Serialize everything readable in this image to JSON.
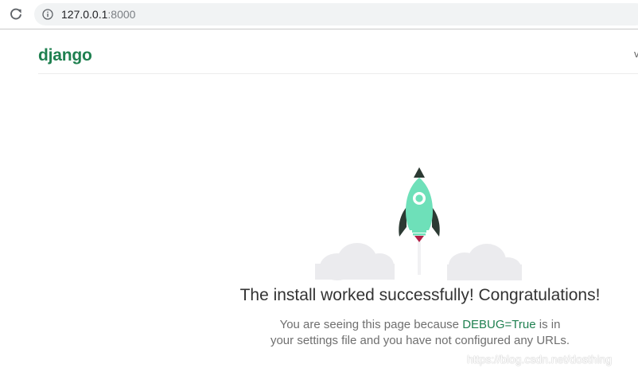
{
  "browser": {
    "url_host": "127.0.0.1",
    "url_port": ":8000"
  },
  "header": {
    "logo": "django",
    "cutoff_text": "v"
  },
  "main": {
    "headline": "The install worked successfully! Congratulations!",
    "sub_before": "You are seeing this page because ",
    "sub_debug": "DEBUG=True",
    "sub_after": " is in your settings file and you have not configured any URLs."
  },
  "watermark": "https://blog.csdn.net/dosthing",
  "colors": {
    "django_green": "#1f8050",
    "rocket_body": "#6ee0b9",
    "rocket_dark": "#2c3a33",
    "flame": "#b21f47",
    "cloud": "#ebebee"
  },
  "icons": {
    "reload": "reload-icon",
    "info": "info-icon",
    "rocket": "rocket-icon"
  }
}
